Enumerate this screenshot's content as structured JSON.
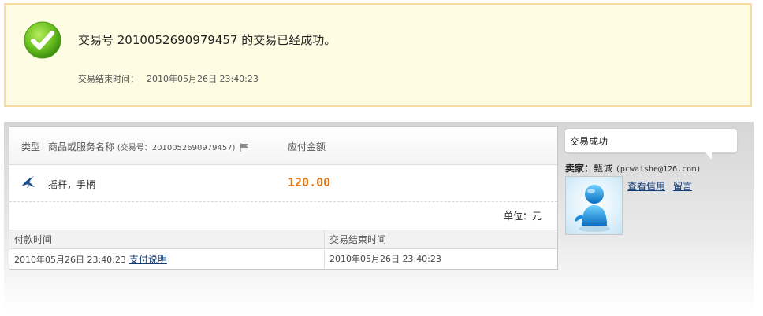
{
  "success": {
    "prefix": "交易号 2010052690979457 的交易已经成功。",
    "end_time_label": "交易结束时间：",
    "end_time_value": "2010年05月26日 23:40:23",
    "status_icon": "check-circle-icon"
  },
  "order": {
    "header": {
      "type_label": "类型",
      "name_label": "商品或服务名称",
      "trade_no_small": "(交易号：2010052690979457)",
      "amount_label": "应付金额"
    },
    "item": {
      "icon": "swallow-icon",
      "name": "摇杆，手柄",
      "amount": "120.00"
    },
    "unit_text": "单位：元",
    "payment_table": {
      "col1_header": "付款时间",
      "col2_header": "交易结束时间",
      "col1_value": "2010年05月26日 23:40:23",
      "col1_link": "支付说明",
      "col2_value": "2010年05月26日 23:40:23"
    }
  },
  "seller": {
    "status_bubble": "交易成功",
    "label": "卖家：",
    "name": "甄诚",
    "email": "(pcwaishe@126.com)",
    "avatar_icon": "user-avatar-icon",
    "links": [
      "查看信用",
      "留言"
    ]
  },
  "colors": {
    "success_bg": "#fefde3",
    "success_border": "#f6dca2",
    "amount": "#e0781a",
    "link": "#123c7a"
  }
}
